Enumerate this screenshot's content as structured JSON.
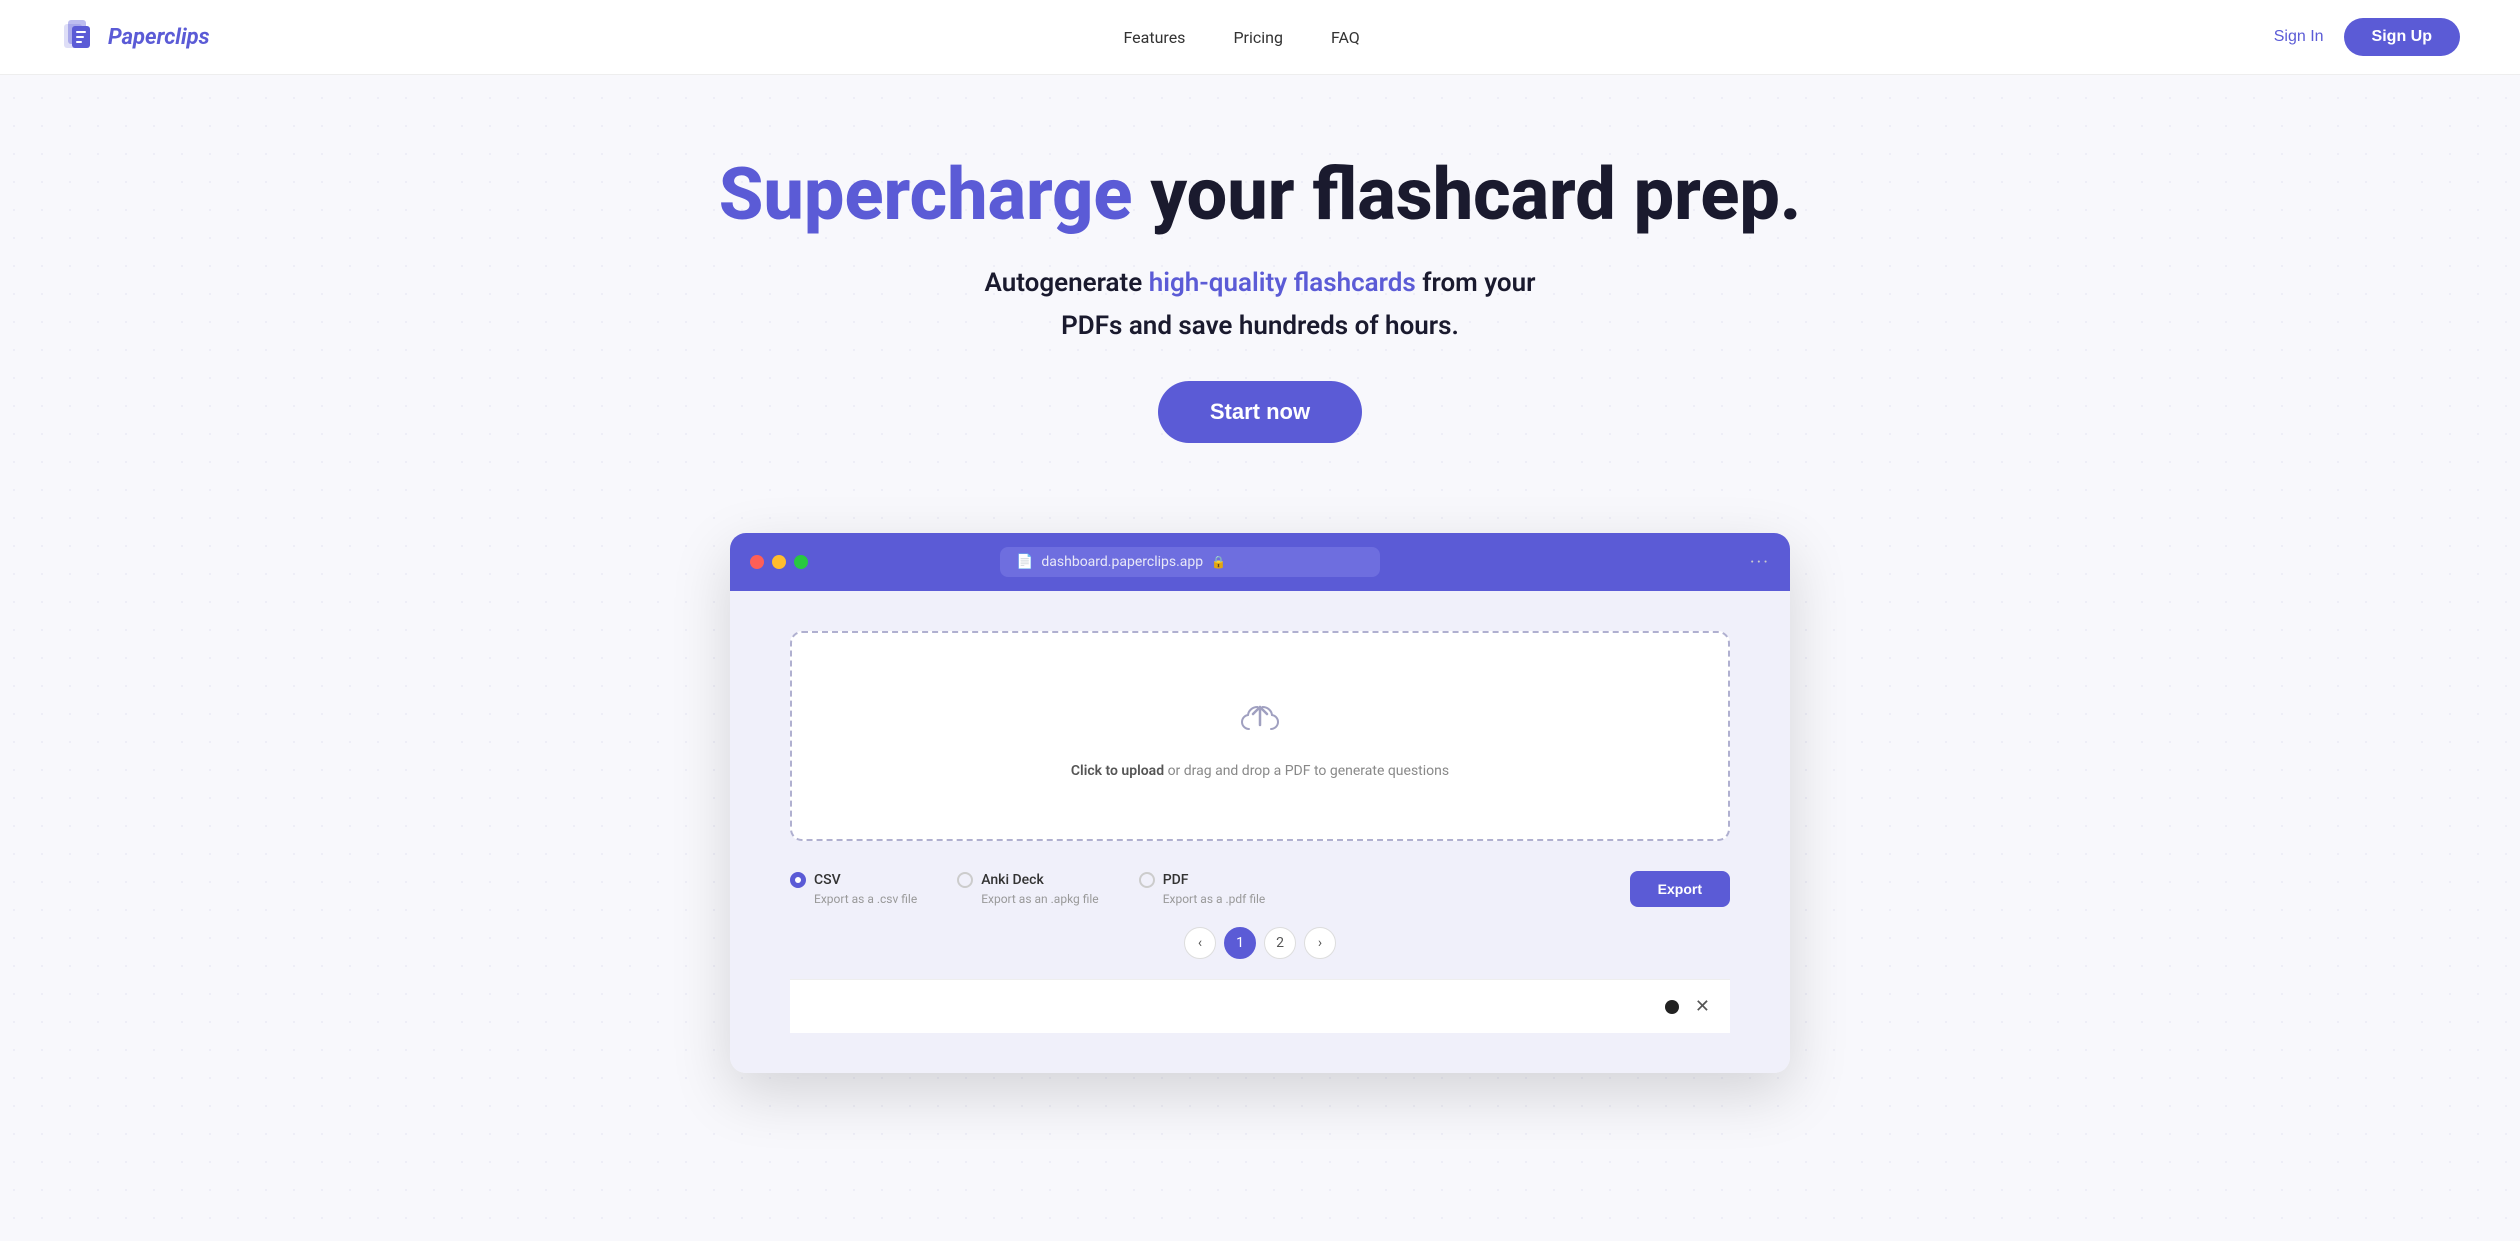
{
  "brand": {
    "name": "Paperclips",
    "logo_alt": "Paperclips logo"
  },
  "nav": {
    "links": [
      {
        "id": "features",
        "label": "Features"
      },
      {
        "id": "pricing",
        "label": "Pricing"
      },
      {
        "id": "faq",
        "label": "FAQ"
      }
    ],
    "sign_in": "Sign In",
    "sign_up": "Sign Up"
  },
  "hero": {
    "title_accent": "Supercharge",
    "title_rest": " your flashcard prep.",
    "subtitle_prefix": "Autogenerate ",
    "subtitle_accent": "high-quality flashcards",
    "subtitle_suffix": " from your",
    "subtitle_line2": "PDFs and save hundreds of hours.",
    "cta": "Start now"
  },
  "browser": {
    "url": "dashboard.paperclips.app",
    "upload_text_bold": "Click to upload",
    "upload_text": " or drag and drop a PDF to generate questions",
    "export_options": [
      {
        "id": "csv",
        "label": "CSV",
        "sublabel": "Export as a .csv file",
        "selected": true
      },
      {
        "id": "anki",
        "label": "Anki Deck",
        "sublabel": "Export as an .apkg file",
        "selected": false
      },
      {
        "id": "pdf",
        "label": "PDF",
        "sublabel": "Export as a .pdf file",
        "selected": false
      }
    ],
    "export_btn": "Export",
    "pagination": {
      "prev": "‹",
      "pages": [
        "1",
        "2"
      ],
      "next": "›",
      "active": "1"
    }
  },
  "dots": {
    "red": "#ff5f57",
    "yellow": "#ffbd2e",
    "green": "#28c841"
  },
  "colors": {
    "accent": "#5b5bd6"
  }
}
